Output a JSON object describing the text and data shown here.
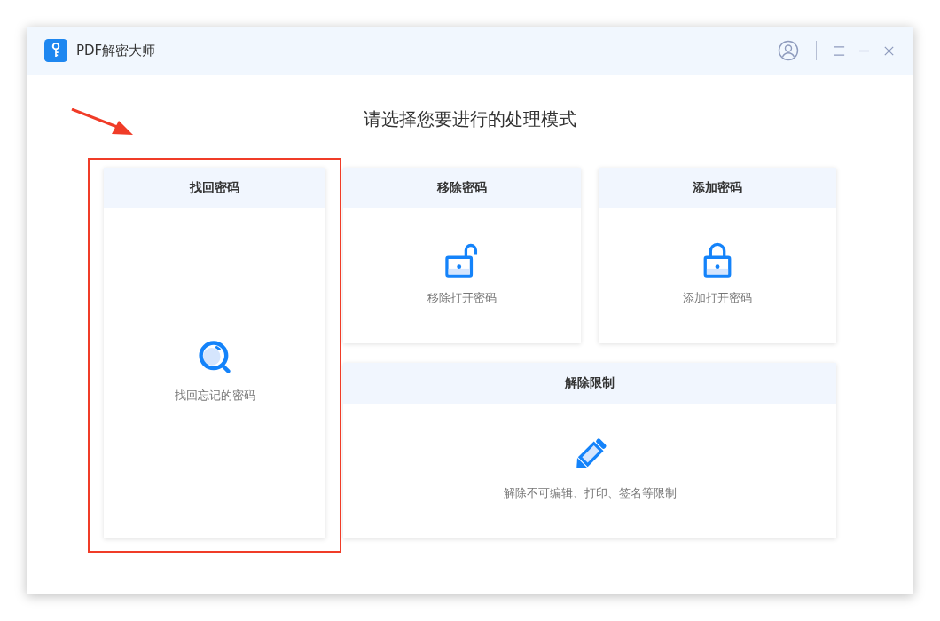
{
  "window": {
    "title": "PDF解密大师"
  },
  "heading": "请选择您要进行的处理模式",
  "modes": [
    {
      "kind": "search",
      "title": "找回密码",
      "description": "找回忘记的密码"
    },
    {
      "kind": "unlock",
      "title": "移除密码",
      "description": "移除打开密码"
    },
    {
      "kind": "lock",
      "title": "添加密码",
      "description": "添加打开密码"
    },
    {
      "kind": "pencil",
      "title": "解除限制",
      "description": "解除不可编辑、打印、签名等限制"
    }
  ]
}
